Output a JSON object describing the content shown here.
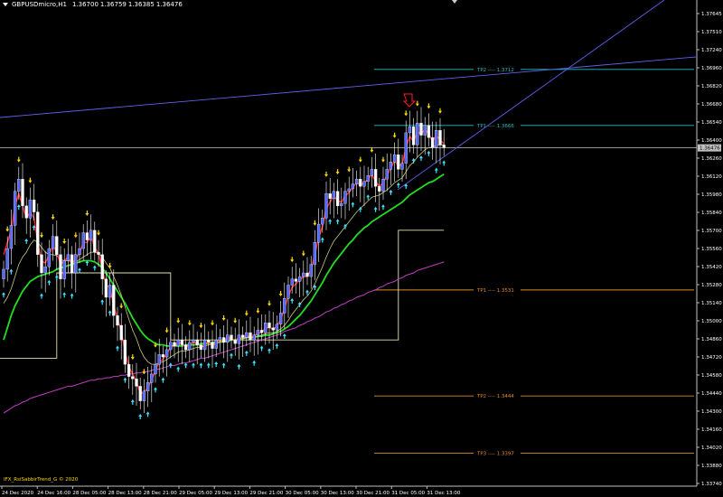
{
  "header": {
    "symbol": "GBPUSDmicro,H1",
    "ohlc": [
      "1.36700",
      "1.36759",
      "1.36385",
      "1.36476"
    ]
  },
  "copyright": "IFX_RsiSabbirTrend_G © 2020",
  "colors": {
    "background": "#000000",
    "bull_candle": "#5566ff",
    "bear_candle": "#ffffff",
    "red_ma": "#ff2020",
    "yellow_ma": "#ccc87a",
    "green_ma": "#22dd22",
    "magenta_ma": "#c040c0",
    "trend_line": "#6060ee",
    "level_line": "#e8e0b0",
    "tp_upper": "#20c0c0",
    "tp_lower": "#e08a20",
    "signal_up": "#40e0ff",
    "signal_down": "#ffd700",
    "current_price_bg": "#bfbfbf"
  },
  "chart_data": {
    "type": "candlestick",
    "price_axis": {
      "range": [
        1.337,
        1.37645
      ],
      "tick_labels": [
        "1.37645",
        "1.37510",
        "1.37240",
        "1.36960",
        "1.36820",
        "1.36680",
        "1.36540",
        "1.36400",
        "1.36260",
        "1.36120",
        "1.35980",
        "1.35840",
        "1.35700",
        "1.35560",
        "1.35420",
        "1.35280",
        "1.35140",
        "1.35000",
        "1.34860",
        "1.34720",
        "1.34580",
        "1.34440",
        "1.34300",
        "1.34160",
        "1.34020",
        "1.33880",
        "1.33740"
      ],
      "current_price": "1.36476"
    },
    "time_axis": {
      "labels": [
        "24 Dec 2020",
        "24 Dec 16:00",
        "28 Dec 05:00",
        "28 Dec 13:00",
        "28 Dec 21:00",
        "29 Dec 05:00",
        "29 Dec 13:00",
        "29 Dec 21:00",
        "30 Dec 05:00",
        "30 Dec 13:00",
        "30 Dec 21:00",
        "31 Dec 05:00",
        "31 Dec 13:00"
      ]
    },
    "levels": [
      {
        "label": "TP2 ---- 1.3712",
        "price": 1.3712,
        "group": "upper"
      },
      {
        "label": "TP1 ---- 1.3666",
        "price": 1.3666,
        "group": "upper"
      },
      {
        "label": "TP1 ---- 1.3531",
        "price": 1.3531,
        "group": "lower"
      },
      {
        "label": "TP2 ---- 1.3444",
        "price": 1.3444,
        "group": "lower"
      },
      {
        "label": "TP3 ---- 1.3397",
        "price": 1.3397,
        "group": "lower"
      }
    ],
    "closes": [
      1.3548,
      1.3565,
      1.3584,
      1.3612,
      1.3622,
      1.36,
      1.359,
      1.3605,
      1.3595,
      1.356,
      1.3545,
      1.355,
      1.3565,
      1.3575,
      1.356,
      1.354,
      1.3555,
      1.356,
      1.3545,
      1.356,
      1.3565,
      1.3578,
      1.3572,
      1.358,
      1.3562,
      1.356,
      1.354,
      1.3525,
      1.3535,
      1.351,
      1.3502,
      1.349,
      1.347,
      1.346,
      1.3458,
      1.3452,
      1.344,
      1.3448,
      1.3455,
      1.3462,
      1.347,
      1.3478,
      1.3476,
      1.3482,
      1.3488,
      1.3485,
      1.349,
      1.3486,
      1.3482,
      1.3488,
      1.349,
      1.3486,
      1.3482,
      1.349,
      1.3488,
      1.3483,
      1.349,
      1.3492,
      1.3488,
      1.3494,
      1.349,
      1.3487,
      1.3494,
      1.3492,
      1.3496,
      1.349,
      1.3494,
      1.3498,
      1.3496,
      1.3504,
      1.35,
      1.3498,
      1.3503,
      1.3512,
      1.3524,
      1.3535,
      1.354,
      1.3538,
      1.3542,
      1.3545,
      1.3542,
      1.3552,
      1.357,
      1.3585,
      1.359,
      1.361,
      1.3606,
      1.3612,
      1.36,
      1.3602,
      1.3612,
      1.3614,
      1.3618,
      1.3622,
      1.3616,
      1.362,
      1.3625,
      1.363,
      1.3616,
      1.3612,
      1.3622,
      1.363,
      1.3636,
      1.3642,
      1.363,
      1.3635,
      1.366,
      1.3665,
      1.365,
      1.3668,
      1.3658,
      1.3666,
      1.3656,
      1.3648,
      1.3662,
      1.365,
      1.3648
    ],
    "red_ma": [
      1.356,
      1.357,
      1.358,
      1.36,
      1.361,
      1.36,
      1.359,
      1.3595,
      1.359,
      1.357,
      1.3555,
      1.3553,
      1.356,
      1.3567,
      1.3562,
      1.3552,
      1.3555,
      1.3558,
      1.3552,
      1.3557,
      1.3561,
      1.357,
      1.357,
      1.3575,
      1.3566,
      1.3561,
      1.3548,
      1.3535,
      1.3533,
      1.3518,
      1.3508,
      1.3497,
      1.348,
      1.3468,
      1.3462,
      1.3456,
      1.3446,
      1.3447,
      1.3451,
      1.3457,
      1.3465,
      1.3472,
      1.3474,
      1.3479,
      1.3484,
      1.3485,
      1.3488,
      1.3487,
      1.3484,
      1.3486,
      1.3488,
      1.3487,
      1.3484,
      1.3487,
      1.3488,
      1.3485,
      1.3488,
      1.349,
      1.3489,
      1.3492,
      1.3491,
      1.3489,
      1.3492,
      1.3492,
      1.3494,
      1.3492,
      1.3493,
      1.3496,
      1.3496,
      1.35,
      1.35,
      1.3499,
      1.3501,
      1.3507,
      1.3516,
      1.3526,
      1.3533,
      1.3536,
      1.3539,
      1.3542,
      1.3542,
      1.3548,
      1.356,
      1.3574,
      1.3583,
      1.3598,
      1.3603,
      1.3608,
      1.3604,
      1.3603,
      1.3608,
      1.3611,
      1.3615,
      1.3619,
      1.3617,
      1.3619,
      1.3622,
      1.3626,
      1.362,
      1.3616,
      1.3619,
      1.3625,
      1.3631,
      1.3637,
      1.3633,
      1.3634,
      1.3648,
      1.3657,
      1.3653,
      1.3661,
      1.3659,
      1.3663,
      1.3659,
      1.3653,
      1.3658,
      1.3654,
      1.3651
    ],
    "yellow_ma": [
      1.352,
      1.3525,
      1.3532,
      1.3542,
      1.3552,
      1.3558,
      1.3562,
      1.3568,
      1.3572,
      1.357,
      1.3566,
      1.3562,
      1.356,
      1.356,
      1.3559,
      1.3556,
      1.3555,
      1.3555,
      1.3554,
      1.3554,
      1.3556,
      1.3558,
      1.356,
      1.3562,
      1.3562,
      1.3561,
      1.3558,
      1.3553,
      1.3549,
      1.3542,
      1.3535,
      1.3527,
      1.3517,
      1.3507,
      1.3498,
      1.3491,
      1.3482,
      1.3476,
      1.3472,
      1.347,
      1.347,
      1.3471,
      1.3472,
      1.3474,
      1.3476,
      1.3478,
      1.348,
      1.3481,
      1.3481,
      1.3482,
      1.3483,
      1.3484,
      1.3484,
      1.3485,
      1.3486,
      1.3486,
      1.3487,
      1.3488,
      1.3488,
      1.3489,
      1.349,
      1.349,
      1.3491,
      1.3491,
      1.3492,
      1.3492,
      1.3492,
      1.3493,
      1.3494,
      1.3495,
      1.3496,
      1.3496,
      1.3497,
      1.3499,
      1.3502,
      1.3506,
      1.3511,
      1.3515,
      1.3519,
      1.3523,
      1.3526,
      1.353,
      1.3536,
      1.3543,
      1.355,
      1.3558,
      1.3565,
      1.3571,
      1.3575,
      1.3579,
      1.3583,
      1.3587,
      1.3591,
      1.3595,
      1.3598,
      1.3601,
      1.3604,
      1.3607,
      1.3608,
      1.3609,
      1.3611,
      1.3613,
      1.3616,
      1.3619,
      1.3621,
      1.3623,
      1.3628,
      1.3633,
      1.3636,
      1.364,
      1.3643,
      1.3646,
      1.3648,
      1.3648,
      1.365,
      1.365,
      1.365
    ],
    "green_ma": [
      1.349,
      1.35,
      1.351,
      1.3518,
      1.3524,
      1.353,
      1.3534,
      1.3538,
      1.354,
      1.3542,
      1.3543,
      1.3544,
      1.3545,
      1.3546,
      1.3548,
      1.3549,
      1.355,
      1.3551,
      1.3552,
      1.3553,
      1.3554,
      1.3555,
      1.3555,
      1.3555,
      1.3554,
      1.3552,
      1.3549,
      1.3545,
      1.354,
      1.3535,
      1.353,
      1.3525,
      1.352,
      1.3514,
      1.3508,
      1.3503,
      1.3498,
      1.3494,
      1.3491,
      1.3489,
      1.3487,
      1.3486,
      1.3486,
      1.3485,
      1.3485,
      1.3485,
      1.3485,
      1.3485,
      1.3486,
      1.3486,
      1.3486,
      1.3486,
      1.3487,
      1.3487,
      1.3487,
      1.3488,
      1.3488,
      1.3489,
      1.3489,
      1.3489,
      1.349,
      1.349,
      1.3491,
      1.3491,
      1.3492,
      1.3492,
      1.3492,
      1.3493,
      1.3493,
      1.3494,
      1.3494,
      1.3495,
      1.3496,
      1.3497,
      1.3499,
      1.3501,
      1.3504,
      1.3507,
      1.351,
      1.3514,
      1.3518,
      1.3522,
      1.3527,
      1.3532,
      1.3537,
      1.3543,
      1.3548,
      1.3553,
      1.3557,
      1.3561,
      1.3565,
      1.3569,
      1.3572,
      1.3576,
      1.3579,
      1.3582,
      1.3584,
      1.3587,
      1.3589,
      1.3591,
      1.3593,
      1.3595,
      1.3597,
      1.3599,
      1.3601,
      1.3603,
      1.3606,
      1.3609,
      1.3611,
      1.3613,
      1.3615,
      1.3617,
      1.3619,
      1.362,
      1.3622,
      1.3624,
      1.3626
    ],
    "magenta_ma": [
      1.343,
      1.3432,
      1.3434,
      1.3436,
      1.3437,
      1.3439,
      1.344,
      1.3442,
      1.3443,
      1.3444,
      1.3445,
      1.3446,
      1.3447,
      1.3448,
      1.3449,
      1.345,
      1.3451,
      1.3452,
      1.3452,
      1.3453,
      1.3454,
      1.3455,
      1.3456,
      1.3457,
      1.3457,
      1.3458,
      1.3458,
      1.3459,
      1.3459,
      1.346,
      1.346,
      1.3461,
      1.3461,
      1.3462,
      1.3462,
      1.3463,
      1.3463,
      1.3464,
      1.3464,
      1.3465,
      1.3466,
      1.3466,
      1.3467,
      1.3468,
      1.3469,
      1.3469,
      1.347,
      1.3471,
      1.3471,
      1.3472,
      1.3473,
      1.3474,
      1.3475,
      1.3475,
      1.3476,
      1.3477,
      1.3478,
      1.3479,
      1.348,
      1.3481,
      1.3482,
      1.3483,
      1.3484,
      1.3485,
      1.3486,
      1.3487,
      1.3488,
      1.3489,
      1.349,
      1.3491,
      1.3492,
      1.3493,
      1.3494,
      1.3495,
      1.3497,
      1.3498,
      1.3499,
      1.35,
      1.3502,
      1.3503,
      1.3505,
      1.3506,
      1.3508,
      1.3509,
      1.3511,
      1.3513,
      1.3514,
      1.3516,
      1.3517,
      1.3519,
      1.352,
      1.3522,
      1.3523,
      1.3525,
      1.3526,
      1.3527,
      1.3529,
      1.353,
      1.3531,
      1.3533,
      1.3534,
      1.3536,
      1.3537,
      1.3538,
      1.354,
      1.3541,
      1.3543,
      1.3544,
      1.3545,
      1.3547,
      1.3548,
      1.3549,
      1.355,
      1.3551,
      1.3552,
      1.3553,
      1.3554
    ],
    "step_line": [
      1.3475,
      1.3475,
      1.3475,
      1.3475,
      1.3475,
      1.3475,
      1.3475,
      1.3475,
      1.3475,
      1.3475,
      1.3475,
      1.3475,
      1.3475,
      1.3475,
      1.3545,
      1.3545,
      1.3545,
      1.3545,
      1.3545,
      1.3545,
      1.3545,
      1.3545,
      1.3545,
      1.3545,
      1.3545,
      1.3545,
      1.3545,
      1.3545,
      1.3545,
      1.3545,
      1.3545,
      1.3545,
      1.3545,
      1.3545,
      1.3545,
      1.3545,
      1.3545,
      1.3545,
      1.3545,
      1.3545,
      1.3545,
      1.3545,
      1.3545,
      1.3545,
      1.349,
      1.349,
      1.349,
      1.349,
      1.349,
      1.349,
      1.349,
      1.349,
      1.349,
      1.349,
      1.349,
      1.349,
      1.349,
      1.349,
      1.349,
      1.349,
      1.349,
      1.349,
      1.349,
      1.349,
      1.349,
      1.349,
      1.349,
      1.349,
      1.349,
      1.349,
      1.349,
      1.349,
      1.349,
      1.349,
      1.349,
      1.349,
      1.349,
      1.349,
      1.349,
      1.349,
      1.349,
      1.349,
      1.349,
      1.349,
      1.349,
      1.349,
      1.349,
      1.349,
      1.349,
      1.349,
      1.349,
      1.349,
      1.349,
      1.349,
      1.349,
      1.349,
      1.349,
      1.349,
      1.349,
      1.349,
      1.349,
      1.349,
      1.349,
      1.349,
      1.358,
      1.358,
      1.358,
      1.358,
      1.358,
      1.358,
      1.358,
      1.358,
      1.358,
      1.358,
      1.358,
      1.358,
      1.358
    ]
  }
}
